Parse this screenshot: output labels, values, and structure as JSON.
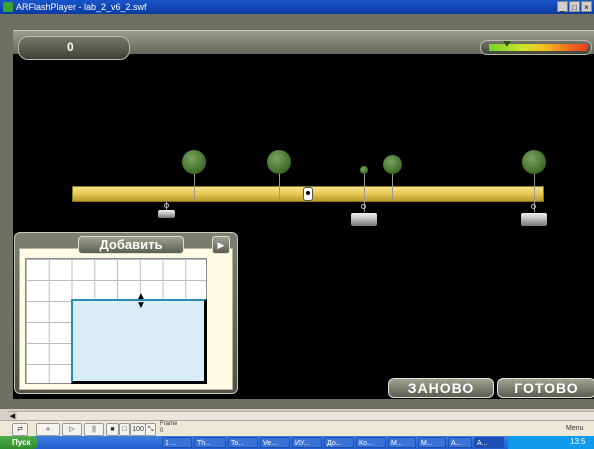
{
  "window": {
    "title": "ARFlashPlayer - lab_2_v6_2.swf",
    "buttons": [
      "_",
      "□",
      "×"
    ]
  },
  "game": {
    "score": "0",
    "meter_level": 0.18,
    "add_button_label": "Добавить",
    "reset_button_label": "ЗАНОВО",
    "done_button_label": "ГОТОВО"
  },
  "player": {
    "controls": [
      "⇄",
      "«",
      "▷",
      "||",
      "■",
      "□",
      "100",
      "⤡"
    ],
    "frame_label": "Frame",
    "frame_value": "0",
    "menu_label": "Menu"
  },
  "taskbar": {
    "start_label": "Пуск",
    "items": [
      "1 ...",
      "Th...",
      "To...",
      "Ve...",
      "ИУ...",
      "До...",
      "Ко...",
      "M...",
      "М...",
      "A...",
      "A..."
    ],
    "clock": "13:5"
  },
  "colors": {
    "stage": "#000000",
    "panel_bg": "#fffbe4",
    "shape_fill": "#d8edf8",
    "ruler": "#e2c24a",
    "balloon": "#3c6a26"
  }
}
